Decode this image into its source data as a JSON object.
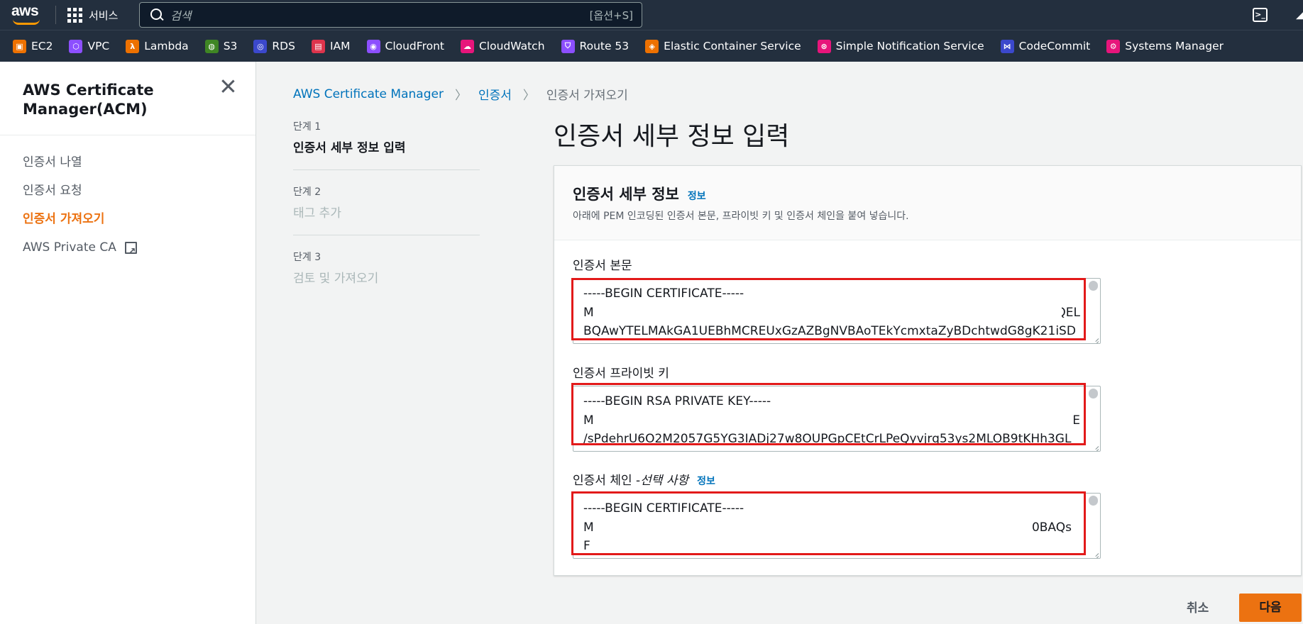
{
  "topnav": {
    "logo_text": "aws",
    "services_label": "서비스",
    "search_placeholder": "검색",
    "search_shortcut": "[옵션+S]",
    "cloudshell_icon": "cloudshell-icon"
  },
  "favorites": [
    {
      "label": "EC2",
      "color": "#ed7100",
      "icon": "ec2-icon"
    },
    {
      "label": "VPC",
      "color": "#8c4fff",
      "icon": "vpc-icon"
    },
    {
      "label": "Lambda",
      "color": "#ed7100",
      "icon": "lambda-icon"
    },
    {
      "label": "S3",
      "color": "#3f8624",
      "icon": "s3-icon"
    },
    {
      "label": "RDS",
      "color": "#3b48cc",
      "icon": "rds-icon"
    },
    {
      "label": "IAM",
      "color": "#dd344c",
      "icon": "iam-icon"
    },
    {
      "label": "CloudFront",
      "color": "#8c4fff",
      "icon": "cloudfront-icon"
    },
    {
      "label": "CloudWatch",
      "color": "#e7157b",
      "icon": "cloudwatch-icon"
    },
    {
      "label": "Route 53",
      "color": "#8c4fff",
      "icon": "route53-icon"
    },
    {
      "label": "Elastic Container Service",
      "color": "#ed7100",
      "icon": "ecs-icon"
    },
    {
      "label": "Simple Notification Service",
      "color": "#e7157b",
      "icon": "sns-icon"
    },
    {
      "label": "CodeCommit",
      "color": "#3b48cc",
      "icon": "codecommit-icon"
    },
    {
      "label": "Systems Manager",
      "color": "#e7157b",
      "icon": "systems-manager-icon"
    }
  ],
  "sidebar": {
    "title": "AWS Certificate Manager(ACM)",
    "items": [
      {
        "label": "인증서 나열"
      },
      {
        "label": "인증서 요청"
      },
      {
        "label": "인증서 가져오기",
        "active": true
      },
      {
        "label": "AWS Private CA",
        "external": true
      }
    ]
  },
  "breadcrumb": {
    "root": "AWS Certificate Manager",
    "parent": "인증서",
    "current": "인증서 가져오기"
  },
  "steps": [
    {
      "num": "단계 1",
      "name": "인증서 세부 정보 입력",
      "current": true
    },
    {
      "num": "단계 2",
      "name": "태그 추가"
    },
    {
      "num": "단계 3",
      "name": "검토 및 가져오기"
    }
  ],
  "page_title": "인증서 세부 정보 입력",
  "panel": {
    "heading": "인증서 세부 정보",
    "info": "정보",
    "description": "아래에 PEM 인코딩된 인증서 본문, 프라이빗 키 및 인증서 체인을 붙여 넣습니다.",
    "fields": {
      "body": {
        "label": "인증서 본문",
        "line1": "-----BEGIN CERTIFICATE-----",
        "line2_start": "M",
        "line2_end": "QEL",
        "line3": "BQAwYTELMAkGA1UEBhMCREUxGzAZBgNVBAoTEkYcmxtaZyBDchtwdG8gK21iSD"
      },
      "key": {
        "label": "인증서 프라이빗 키",
        "line1": "-----BEGIN RSA PRIVATE KEY-----",
        "line2_start": "M",
        "line2_end": "E",
        "line3": "/sPdehrU6O2M2057G5YG3IADj27w8OUPGpCEtCrLPeQyvjrq53ys2MLOB9tKHh3GL"
      },
      "chain": {
        "label": "인증서 체인 - ",
        "optional": "선택 사항",
        "info": "정보",
        "line1": "-----BEGIN CERTIFICATE-----",
        "line2_start": "M",
        "line2_end": "0BAQs",
        "line3": "F"
      }
    }
  },
  "footer": {
    "cancel": "취소",
    "next": "다음"
  }
}
